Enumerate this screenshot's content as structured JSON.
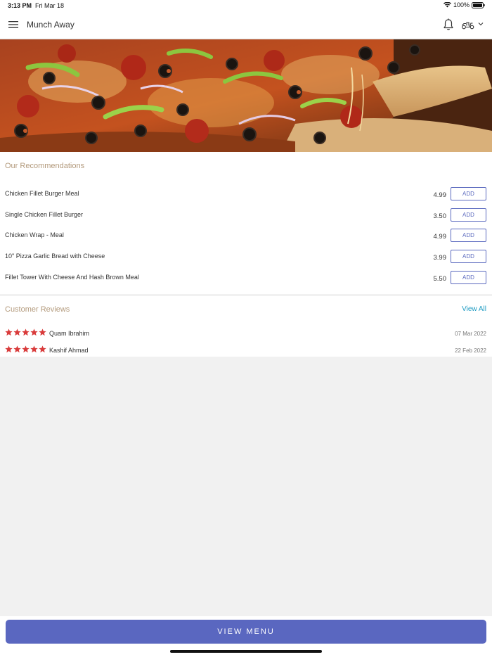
{
  "status_bar": {
    "time": "3:13 PM",
    "date": "Fri Mar 18",
    "battery": "100%"
  },
  "header": {
    "title": "Munch Away",
    "icons": [
      "menu-icon",
      "bell-icon",
      "delivery-scooter-icon",
      "chevron-down-icon"
    ]
  },
  "hero": {
    "image": "pizza-hero-image"
  },
  "recommendations": {
    "title": "Our Recommendations",
    "items": [
      {
        "name": "Chicken Fillet Burger Meal",
        "price": "4.99",
        "button": "ADD"
      },
      {
        "name": "Single Chicken Fillet Burger",
        "price": "3.50",
        "button": "ADD"
      },
      {
        "name": "Chicken Wrap - Meal",
        "price": "4.99",
        "button": "ADD"
      },
      {
        "name": "10\" Pizza Garlic Bread with Cheese",
        "price": "3.99",
        "button": "ADD"
      },
      {
        "name": "Fillet Tower With Cheese And Hash Brown Meal",
        "price": "5.50",
        "button": "ADD"
      }
    ]
  },
  "reviews": {
    "title": "Customer Reviews",
    "view_all": "View All",
    "items": [
      {
        "name": "Quam Ibrahim",
        "date": "07 Mar 2022",
        "rating": 5
      },
      {
        "name": "Kashif Ahmad",
        "date": "22 Feb 2022",
        "rating": 5
      }
    ]
  },
  "footer": {
    "view_menu": "VIEW MENU"
  },
  "colors": {
    "accent": "#5a67c0",
    "section_title": "#b39a7c",
    "link": "#1e9bc2",
    "star": "#d93b3b"
  }
}
